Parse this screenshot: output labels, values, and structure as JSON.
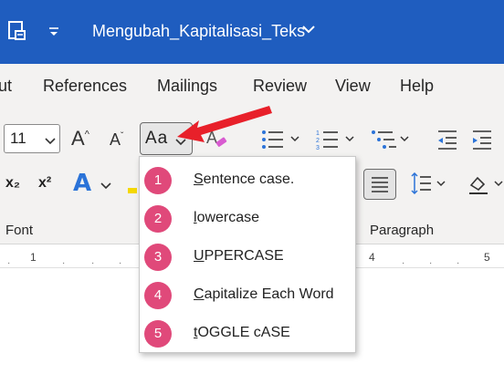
{
  "window": {
    "title": "Mengubah_Kapitalisasi_Teks",
    "colors": {
      "titlebar": "#1f5dbf",
      "ribbon": "#f3f2f1",
      "badge": "#e0497a",
      "arrow": "#e8202a"
    }
  },
  "tabs": [
    {
      "label": "ut"
    },
    {
      "label": "References"
    },
    {
      "label": "Mailings"
    },
    {
      "label": "Review"
    },
    {
      "label": "View"
    },
    {
      "label": "Help"
    }
  ],
  "font_group": {
    "font_size": "11",
    "grow_label": "A",
    "shrink_label": "A",
    "change_case_label": "Aa",
    "subscript_label": "x₂",
    "superscript_label": "x²",
    "text_effects_label": "A",
    "group_name": "Font"
  },
  "paragraph_group": {
    "group_name": "Paragraph"
  },
  "ruler": {
    "marks": [
      "1",
      "4",
      "5"
    ]
  },
  "change_case_menu": {
    "items": [
      {
        "number": "1",
        "label": "Sentence case."
      },
      {
        "number": "2",
        "label": "lowercase"
      },
      {
        "number": "3",
        "label": "UPPERCASE"
      },
      {
        "number": "4",
        "label": "Capitalize Each Word"
      },
      {
        "number": "5",
        "label": "tOGGLE cASE"
      }
    ]
  },
  "icons": [
    "save-icon",
    "customize-quick-access-icon",
    "chevron-down-icon",
    "clear-formatting-icon",
    "bullets-icon",
    "numbering-icon",
    "multilevel-list-icon",
    "decrease-indent-icon",
    "increase-indent-icon",
    "align-left-icon",
    "line-spacing-icon",
    "shading-icon",
    "annotation-arrow-icon"
  ]
}
